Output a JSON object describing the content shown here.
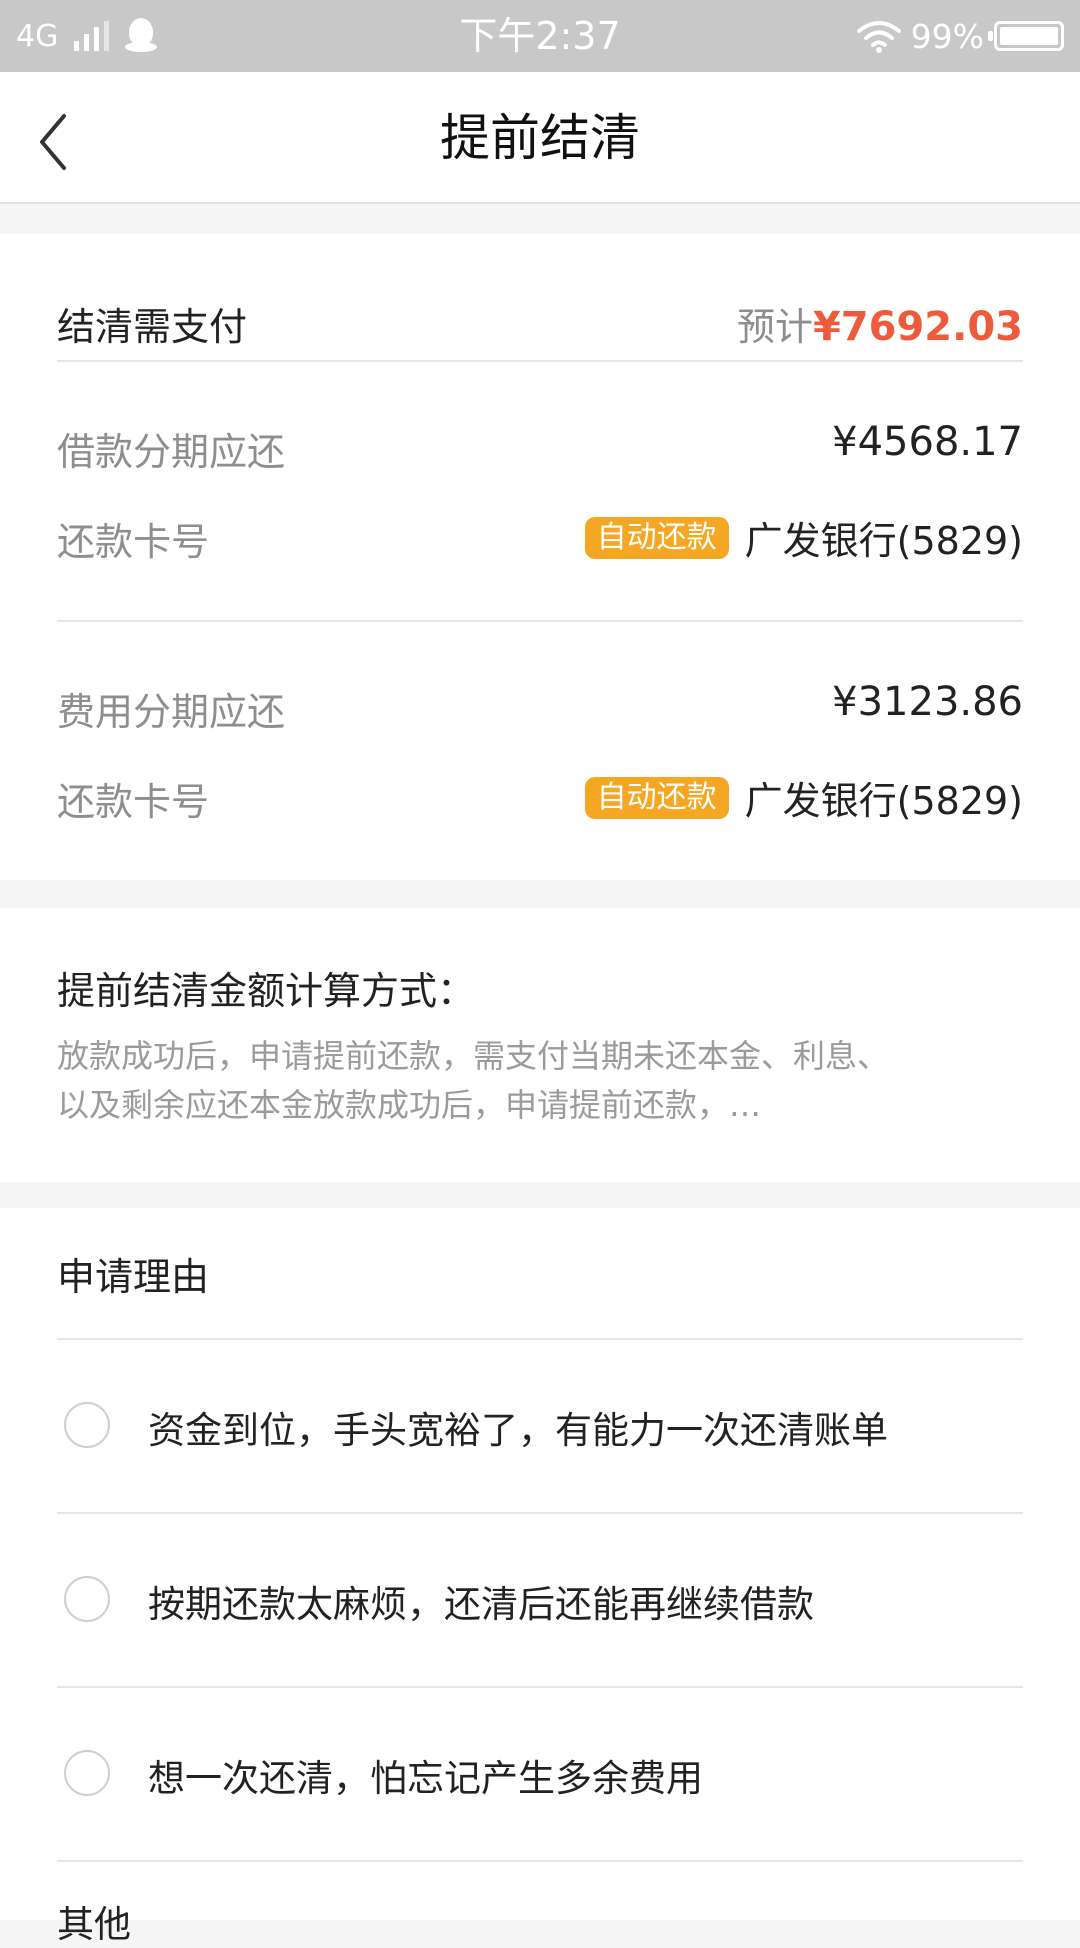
{
  "status_bar": {
    "network": "4G",
    "time": "下午2:37",
    "battery": "99%"
  },
  "header": {
    "title": "提前结清"
  },
  "summary": {
    "label": "结清需支付",
    "estimate_label": "预计",
    "estimate_value": "¥7692.03"
  },
  "loan": {
    "label": "借款分期应还",
    "amount": "¥4568.17",
    "card_label": "还款卡号",
    "badge": "自动还款",
    "bank": "广发银行(5829)"
  },
  "fee": {
    "label": "费用分期应还",
    "amount": "¥3123.86",
    "card_label": "还款卡号",
    "badge": "自动还款",
    "bank": "广发银行(5829)"
  },
  "calc": {
    "title": "提前结清金额计算方式：",
    "body": "放款成功后，申请提前还款，需支付当期未还本金、利息、以及剩余应还本金放款成功后，申请提前还款，…"
  },
  "reasons": {
    "title": "申请理由",
    "options": [
      "资金到位，手头宽裕了，有能力一次还清账单",
      "按期还款太麻烦，还清后还能再继续借款",
      "想一次还清，怕忘记产生多余费用"
    ],
    "other": "其他"
  }
}
